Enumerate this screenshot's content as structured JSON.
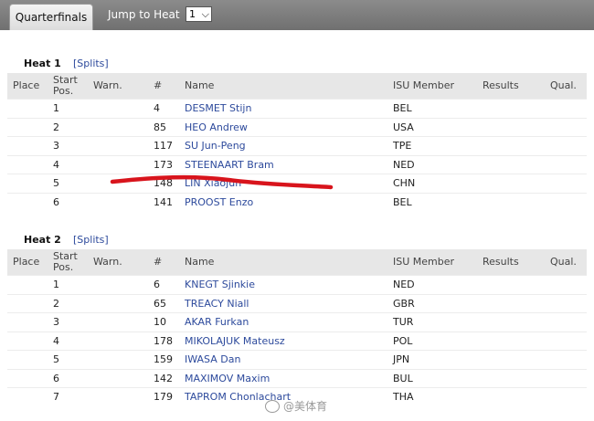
{
  "topbar": {
    "active_tab": "Quarterfinals",
    "jump_label": "Jump to Heat",
    "jump_value": "1"
  },
  "headers": {
    "place": "Place",
    "start_pos": "Start Pos.",
    "warn": "Warn.",
    "num": "#",
    "name": "Name",
    "isu": "ISU Member",
    "results": "Results",
    "qual": "Qual."
  },
  "heats": [
    {
      "title": "Heat 1",
      "splits": "[Splits]",
      "rows": [
        {
          "start": "1",
          "num": "4",
          "name": "DESMET Stijn",
          "isu": "BEL"
        },
        {
          "start": "2",
          "num": "85",
          "name": "HEO Andrew",
          "isu": "USA"
        },
        {
          "start": "3",
          "num": "117",
          "name": "SU Jun-Peng",
          "isu": "TPE"
        },
        {
          "start": "4",
          "num": "173",
          "name": "STEENAART Bram",
          "isu": "NED"
        },
        {
          "start": "5",
          "num": "148",
          "name": "LIN Xiaojun",
          "isu": "CHN"
        },
        {
          "start": "6",
          "num": "141",
          "name": "PROOST Enzo",
          "isu": "BEL"
        }
      ]
    },
    {
      "title": "Heat 2",
      "splits": "[Splits]",
      "rows": [
        {
          "start": "1",
          "num": "6",
          "name": "KNEGT Sjinkie",
          "isu": "NED"
        },
        {
          "start": "2",
          "num": "65",
          "name": "TREACY Niall",
          "isu": "GBR"
        },
        {
          "start": "3",
          "num": "10",
          "name": "AKAR Furkan",
          "isu": "TUR"
        },
        {
          "start": "4",
          "num": "178",
          "name": "MIKOLAJUK Mateusz",
          "isu": "POL"
        },
        {
          "start": "5",
          "num": "159",
          "name": "IWASA Dan",
          "isu": "JPN"
        },
        {
          "start": "6",
          "num": "142",
          "name": "MAXIMOV Maxim",
          "isu": "BUL"
        },
        {
          "start": "7",
          "num": "179",
          "name": "TAPROM Chonlachart",
          "isu": "THA"
        }
      ]
    }
  ],
  "watermark": "@美体育",
  "colors": {
    "link": "#2d4a9c",
    "header_bg": "#e7e7e7",
    "topbar": "#7a7a7a",
    "marker": "#d8141c"
  }
}
